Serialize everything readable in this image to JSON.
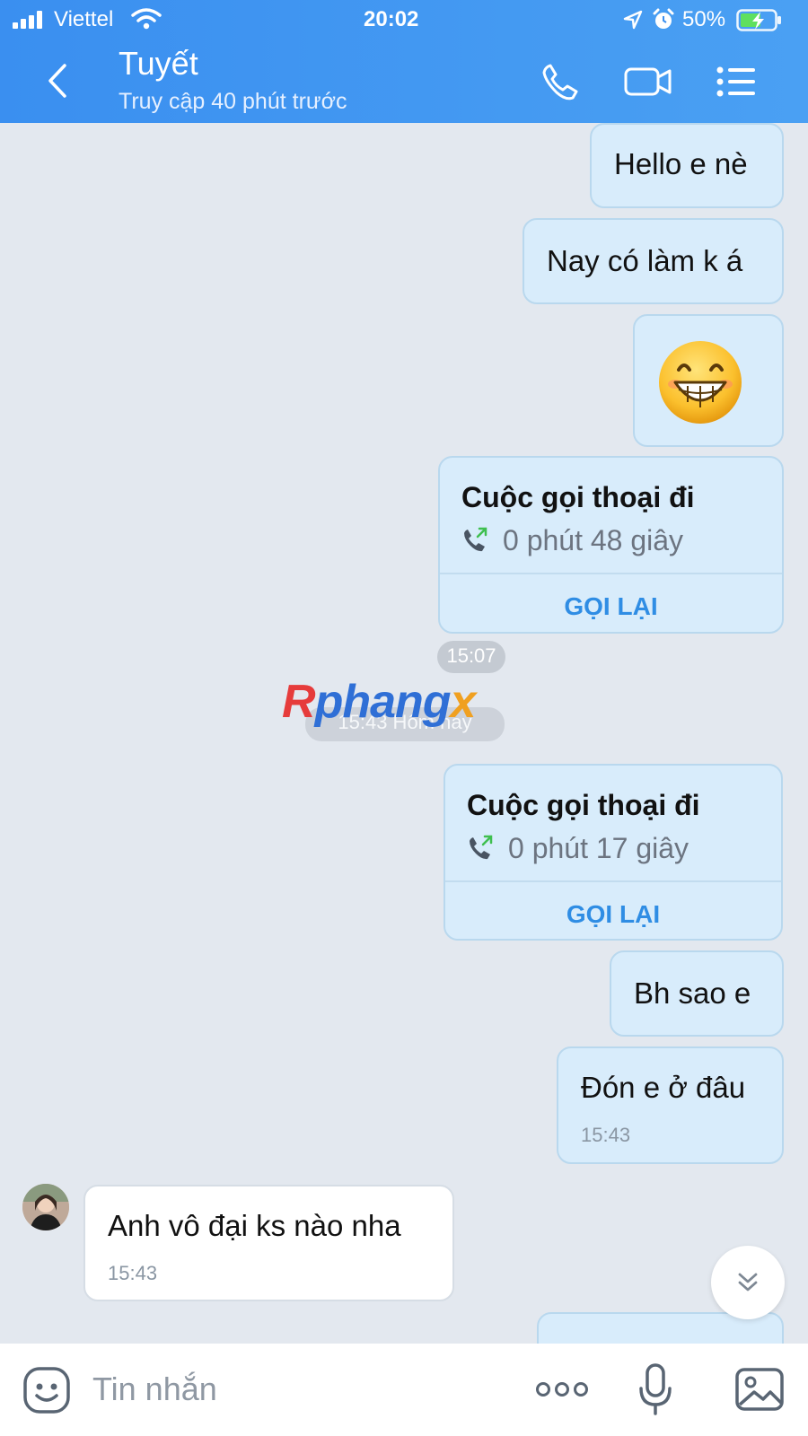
{
  "status_bar": {
    "carrier": "Viettel",
    "time": "20:02",
    "battery_percent": "50%"
  },
  "header": {
    "contact_name": "Tuyết",
    "last_seen": "Truy cập 40 phút trước"
  },
  "messages": {
    "m1": {
      "text": "Hello e nè"
    },
    "m2": {
      "text": "Nay có làm k á"
    },
    "m4": {
      "title": "Cuộc gọi thoại đi",
      "duration": "0 phút 48 giây",
      "action": "GỌI LẠI"
    },
    "m6": {
      "title": "Cuộc gọi thoại đi",
      "duration": "0 phút 17 giây",
      "action": "GỌI LẠI"
    },
    "m7": {
      "text": "Bh sao e"
    },
    "m8": {
      "text": "Đón e ở đâu",
      "time": "15:43"
    },
    "m9": {
      "text": "Anh vô đại ks nào nha",
      "time": "15:43"
    }
  },
  "separators": {
    "time1": "15:07",
    "time2": "15:43 Hôm nay"
  },
  "watermark": "Rphangx",
  "input": {
    "placeholder": "Tin nhắn"
  },
  "colors": {
    "header": "#3a8ff0",
    "bubble_out": "#d8ecfb",
    "bubble_in": "#ffffff",
    "accent": "#2f8de4"
  }
}
